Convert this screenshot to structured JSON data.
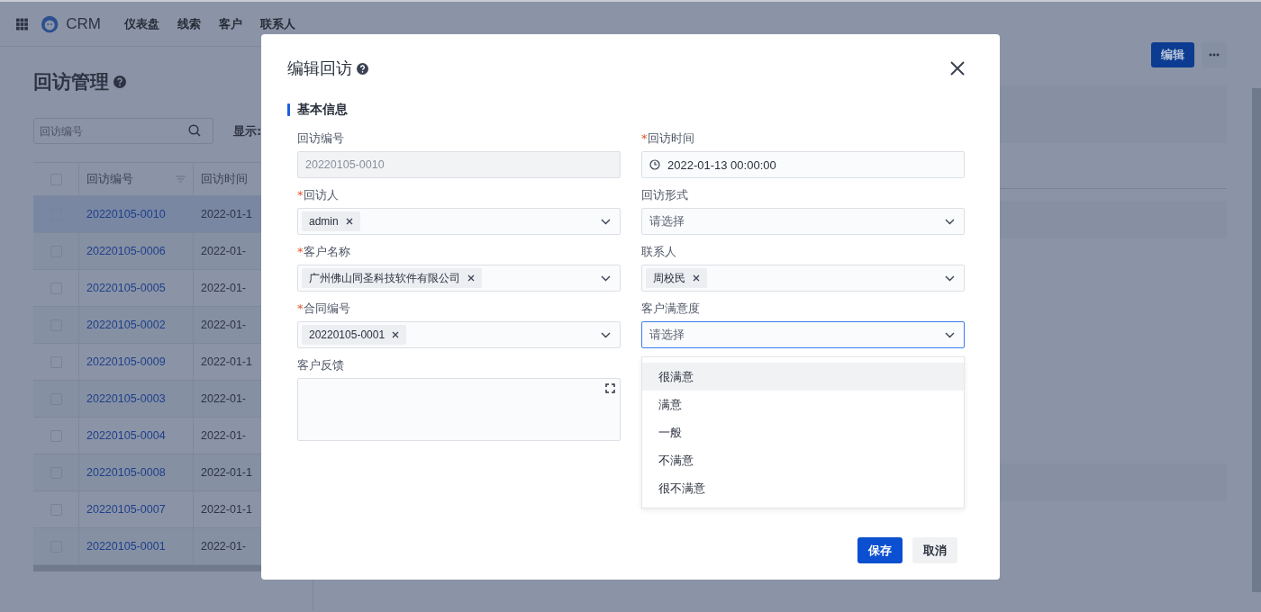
{
  "app": {
    "name": "CRM",
    "nav": [
      "仪表盘",
      "线索",
      "客户",
      "联系人"
    ]
  },
  "list": {
    "title": "回访管理",
    "search_placeholder": "回访编号",
    "display_label": "显示:",
    "columns": [
      "回访编号",
      "回访时间"
    ],
    "all_checked": false,
    "rows": [
      {
        "id": "20220105-0010",
        "time": "2022-01-1",
        "selected": true,
        "checked": false
      },
      {
        "id": "20220105-0006",
        "time": "2022-01-",
        "selected": false,
        "checked": false
      },
      {
        "id": "20220105-0005",
        "time": "2022-01-",
        "selected": false,
        "checked": false
      },
      {
        "id": "20220105-0002",
        "time": "2022-01-",
        "selected": false,
        "checked": false
      },
      {
        "id": "20220105-0009",
        "time": "2022-01-1",
        "selected": false,
        "checked": false
      },
      {
        "id": "20220105-0003",
        "time": "2022-01-",
        "selected": false,
        "checked": false
      },
      {
        "id": "20220105-0004",
        "time": "2022-01-",
        "selected": false,
        "checked": false
      },
      {
        "id": "20220105-0008",
        "time": "2022-01-1",
        "selected": false,
        "checked": false
      },
      {
        "id": "20220105-0007",
        "time": "2022-01-1",
        "selected": false,
        "checked": false
      },
      {
        "id": "20220105-0001",
        "time": "2022-01-",
        "selected": false,
        "checked": false
      }
    ]
  },
  "detail": {
    "edit_button": "编辑"
  },
  "modal": {
    "title": "编辑回访",
    "section": "基本信息",
    "required_mark": "*",
    "fields": [
      {
        "kind": "text",
        "label": "回访编号",
        "required": false,
        "disabled": true,
        "value": "20220105-0010"
      },
      {
        "kind": "date",
        "label": "回访时间",
        "required": true,
        "value": "2022-01-13 00:00:00"
      },
      {
        "kind": "tags",
        "label": "回访人",
        "required": true,
        "tags": [
          "admin"
        ]
      },
      {
        "kind": "select",
        "label": "回访形式",
        "required": false,
        "placeholder": "请选择",
        "focused": false
      },
      {
        "kind": "tags",
        "label": "客户名称",
        "required": true,
        "tags": [
          "广州佛山同圣科技软件有限公司"
        ]
      },
      {
        "kind": "tags",
        "label": "联系人",
        "required": false,
        "tags": [
          "周校民"
        ]
      },
      {
        "kind": "tags",
        "label": "合同编号",
        "required": true,
        "tags": [
          "20220105-0001"
        ]
      },
      {
        "kind": "select",
        "label": "客户满意度",
        "required": false,
        "placeholder": "请选择",
        "focused": true,
        "options": [
          {
            "label": "很满意",
            "hovered": true
          },
          {
            "label": "满意",
            "hovered": false
          },
          {
            "label": "一般",
            "hovered": false
          },
          {
            "label": "不满意",
            "hovered": false
          },
          {
            "label": "很不满意",
            "hovered": false
          }
        ]
      },
      {
        "kind": "textarea",
        "label": "客户反馈",
        "required": false
      }
    ],
    "buttons": [
      {
        "label": "保存",
        "kind": "primary"
      },
      {
        "label": "取消",
        "kind": "default"
      }
    ]
  }
}
